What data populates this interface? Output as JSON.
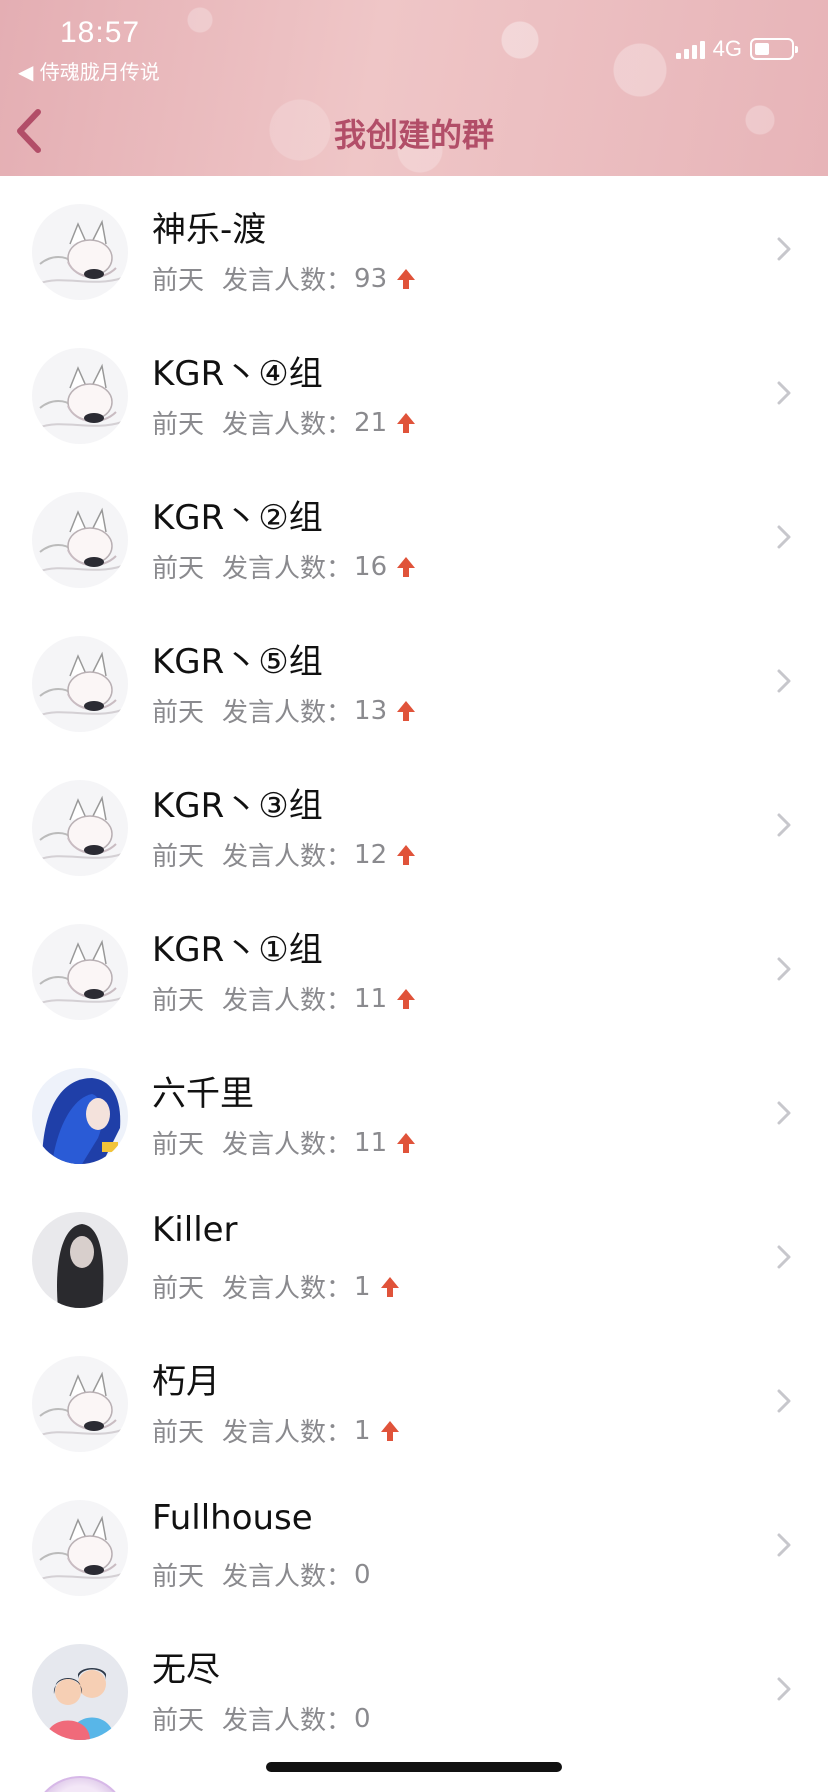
{
  "status_bar": {
    "time": "18:57",
    "back_app": "◀ 侍魂胧月传说",
    "network": "4G"
  },
  "nav": {
    "title": "我创建的群"
  },
  "groups": [
    {
      "name": "神乐-渡",
      "day": "前天",
      "speakers_label": "发言人数：",
      "count": "93",
      "trend": "up",
      "avatar": "anime-white-fox-girl"
    },
    {
      "name": "KGR丶④组",
      "day": "前天",
      "speakers_label": "发言人数：",
      "count": "21",
      "trend": "up",
      "avatar": "anime-white-fox-girl"
    },
    {
      "name": "KGR丶②组",
      "day": "前天",
      "speakers_label": "发言人数：",
      "count": "16",
      "trend": "up",
      "avatar": "anime-white-fox-girl"
    },
    {
      "name": "KGR丶⑤组",
      "day": "前天",
      "speakers_label": "发言人数：",
      "count": "13",
      "trend": "up",
      "avatar": "anime-white-wolf-girl"
    },
    {
      "name": "KGR丶③组",
      "day": "前天",
      "speakers_label": "发言人数：",
      "count": "12",
      "trend": "up",
      "avatar": "anime-white-wolf-girl"
    },
    {
      "name": "KGR丶①组",
      "day": "前天",
      "speakers_label": "发言人数：",
      "count": "11",
      "trend": "up",
      "avatar": "anime-white-wolf-girl"
    },
    {
      "name": "六千里",
      "day": "前天",
      "speakers_label": "发言人数：",
      "count": "11",
      "trend": "up",
      "avatar": "blue-hair-character"
    },
    {
      "name": "Killer",
      "day": "前天",
      "speakers_label": "发言人数：",
      "count": "1",
      "trend": "up",
      "avatar": "dark-hair-girl"
    },
    {
      "name": "朽月",
      "day": "前天",
      "speakers_label": "发言人数：",
      "count": "1",
      "trend": "up",
      "avatar": "anime-white-wolf-girl"
    },
    {
      "name": "Fullhouse",
      "day": "前天",
      "speakers_label": "发言人数：",
      "count": "0",
      "trend": "none",
      "avatar": "anime-white-wolf-girl"
    },
    {
      "name": "无尽",
      "day": "前天",
      "speakers_label": "发言人数：",
      "count": "0",
      "trend": "none",
      "avatar": "default-couple"
    }
  ],
  "colors": {
    "title": "#b24e68",
    "trend_up": "#e0533a",
    "meta_text": "#8a8a8e"
  }
}
